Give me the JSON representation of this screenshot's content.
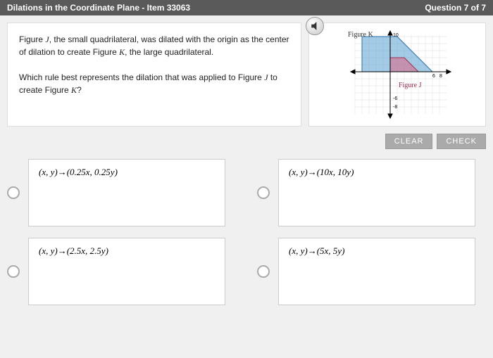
{
  "header": {
    "title": "Dilations in the Coordinate Plane - Item 33063",
    "progress": "Question 7 of 7"
  },
  "question": {
    "line1_pre": "Figure ",
    "figJ": "J",
    "line1_mid": ", the small quadrilateral, was dilated with the origin as the center of dilation to create Figure ",
    "figK": "K",
    "line1_post": ", the large quadrilateral.",
    "line2_pre": "Which rule best represents the dilation that was applied to Figure ",
    "line2_mid": " to create Figure ",
    "line2_post": "?"
  },
  "figure": {
    "labelK": "Figure K",
    "labelJ": "Figure J"
  },
  "buttons": {
    "clear": "CLEAR",
    "check": "CHECK"
  },
  "choices": {
    "a": "(x, y)→(0.25x, 0.25y)",
    "b": "(x, y)→(10x, 10y)",
    "c": "(x, y)→(2.5x, 2.5y)",
    "d": "(x, y)→(5x, 5y)"
  }
}
